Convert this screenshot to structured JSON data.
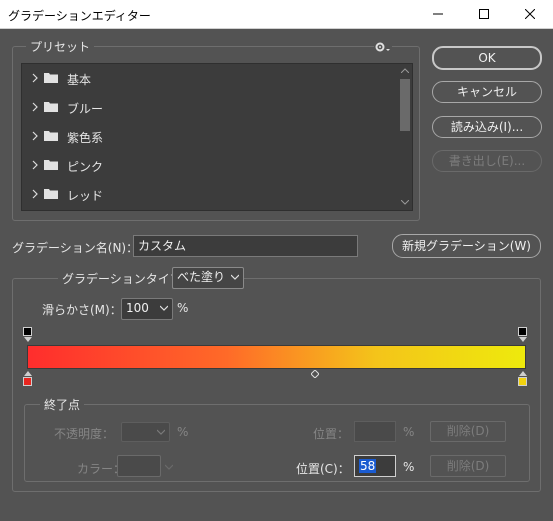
{
  "window": {
    "title": "グラデーションエディター"
  },
  "presets": {
    "legend": "プリセット",
    "items": [
      {
        "label": "基本"
      },
      {
        "label": "ブルー"
      },
      {
        "label": "紫色系"
      },
      {
        "label": "ピンク"
      },
      {
        "label": "レッド"
      }
    ]
  },
  "buttons": {
    "ok": "OK",
    "cancel": "キャンセル",
    "load": "読み込み(I)...",
    "export": "書き出し(E)...",
    "new_gradient": "新規グラデーション(W)"
  },
  "name_field": {
    "label": "グラデーション名(N)：",
    "value": "カスタム"
  },
  "gradient_type": {
    "label": "グラデーションタイプ：",
    "value": "べた塗り"
  },
  "smoothness": {
    "label": "滑らかさ(M)：",
    "value": "100",
    "unit": "%"
  },
  "gradient": {
    "colors": [
      "#ff2d2d",
      "#ff6a28",
      "#f4c41a",
      "#eeea0c"
    ],
    "color_stops": [
      {
        "position": 0,
        "color": "#e8261f"
      },
      {
        "position": 100,
        "color": "#f2d20e"
      }
    ],
    "opacity_stops": [
      {
        "position": 0
      },
      {
        "position": 100
      }
    ],
    "midpoint": 58
  },
  "stops": {
    "legend": "終了点",
    "opacity_label": "不透明度：",
    "opacity_unit": "%",
    "opacity_position_label": "位置：",
    "opacity_position_unit": "%",
    "delete_opacity": "削除(D)",
    "color_label": "カラー：",
    "color_position_label": "位置(C)：",
    "color_position_value": "58",
    "color_position_unit": "%",
    "delete_color": "削除(D)"
  }
}
